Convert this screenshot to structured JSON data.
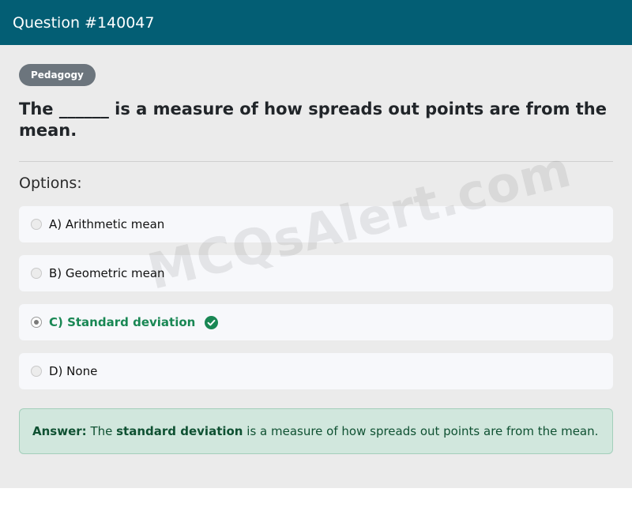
{
  "header": {
    "title": "Question #140047"
  },
  "badge": {
    "label": "Pedagogy"
  },
  "question": {
    "text": "The ______ is a measure of how spreads out points are from the mean."
  },
  "options_label": "Options:",
  "options": [
    {
      "label": "A) Arithmetic mean",
      "selected": false,
      "correct": false
    },
    {
      "label": "B) Geometric mean",
      "selected": false,
      "correct": false
    },
    {
      "label": "C) Standard deviation",
      "selected": true,
      "correct": true
    },
    {
      "label": "D) None",
      "selected": false,
      "correct": false
    }
  ],
  "answer": {
    "prefix": "Answer:",
    "text_before": "The",
    "highlight": "standard deviation",
    "text_after": "is a measure of how spreads out points are from the mean."
  },
  "watermark": "MCQsAlert.com",
  "colors": {
    "header_bg": "#035e74",
    "badge_bg": "#6c757d",
    "correct_green": "#198754",
    "answer_bg": "#d1e7dd"
  }
}
